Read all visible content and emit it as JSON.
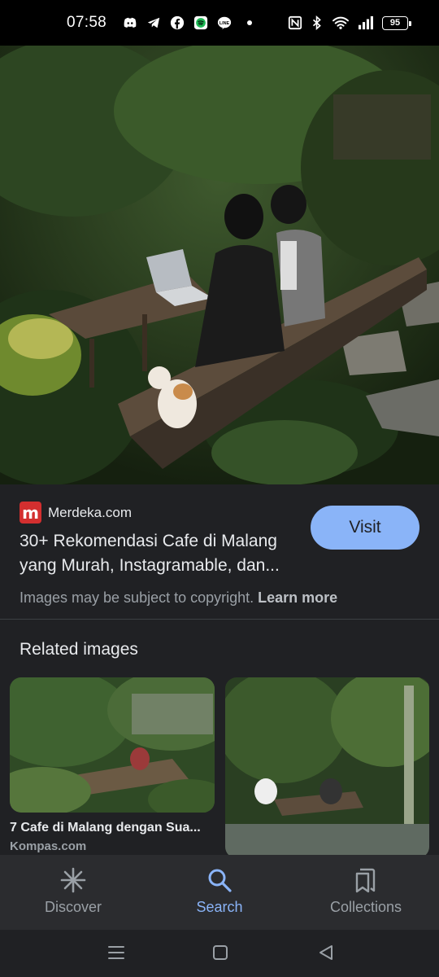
{
  "status_bar": {
    "time": "07:58",
    "battery": "95",
    "left_icons": [
      "discord-icon",
      "telegram-icon",
      "facebook-icon",
      "spotify-icon",
      "line-icon",
      "dot-indicator"
    ],
    "right_icons": [
      "nfc-icon",
      "bluetooth-icon",
      "wifi-icon",
      "signal-icon",
      "battery-icon"
    ]
  },
  "result": {
    "source_logo_letter": "m",
    "source_name": "Merdeka.com",
    "title": "30+ Rekomendasi Cafe di Malang yang Murah, Instagramable, dan...",
    "visit_label": "Visit",
    "copyright_text": "Images may be subject to copyright.",
    "learn_more": "Learn more"
  },
  "related": {
    "heading": "Related images",
    "items": [
      {
        "caption": "7 Cafe di Malang dengan Sua...",
        "source": "Kompas.com"
      },
      {
        "caption": "",
        "source": ""
      }
    ]
  },
  "bottom_nav": {
    "items": [
      {
        "label": "Discover",
        "icon": "asterisk-icon",
        "active": false
      },
      {
        "label": "Search",
        "icon": "search-icon",
        "active": true
      },
      {
        "label": "Collections",
        "icon": "collections-icon",
        "active": false
      }
    ]
  },
  "colors": {
    "background": "#202124",
    "accent": "#8ab4f8",
    "brand_logo": "#d32f2f"
  }
}
